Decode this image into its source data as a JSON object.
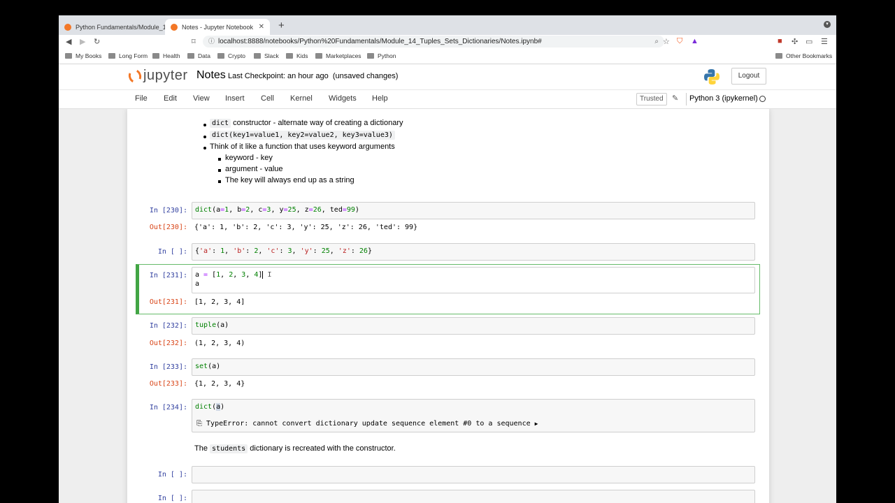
{
  "browser": {
    "tabs": [
      {
        "label": "Python Fundamentals/Module_14_"
      },
      {
        "label": "Notes - Jupyter Notebook"
      }
    ],
    "url": "localhost:8888/notebooks/Python%20Fundamentals/Module_14_Tuples_Sets_Dictionaries/Notes.ipynb#",
    "bookmarks": [
      "My Books",
      "Long Form",
      "Health",
      "Data",
      "Crypto",
      "Slack",
      "Kids",
      "Marketplaces",
      "Python"
    ],
    "other_bookmarks": "Other Bookmarks"
  },
  "jupyter": {
    "logo_text": "jupyter",
    "notebook_name": "Notes",
    "checkpoint": "Last Checkpoint: an hour ago",
    "unsaved": "(unsaved changes)",
    "logout": "Logout",
    "menus": [
      "File",
      "Edit",
      "View",
      "Insert",
      "Cell",
      "Kernel",
      "Widgets",
      "Help"
    ],
    "trusted": "Trusted",
    "kernel": "Python 3 (ipykernel)"
  },
  "markdown": {
    "b1_code": "dict",
    "b1_text": "constructor - alternate way of creating a dictionary",
    "b2_code": "dict(key1=value1, key2=value2, key3=value3)",
    "b3_text": "Think of it like a function that uses keyword arguments",
    "sub1": "keyword - key",
    "sub2": "argument - value",
    "sub3": "The key will always end up as a string"
  },
  "cells": {
    "c230_in": "In [230]:",
    "c230_out_prompt": "Out[230]:",
    "c230_out": "{'a': 1, 'b': 2, 'c': 3, 'y': 25, 'z': 26, 'ted': 99}",
    "blank_in": "In [ ]:",
    "c231_in": "In [231]:",
    "c231_out_prompt": "Out[231]:",
    "c231_out": "[1, 2, 3, 4]",
    "c232_in": "In [232]:",
    "c232_out_prompt": "Out[232]:",
    "c232_out": "(1, 2, 3, 4)",
    "c233_in": "In [233]:",
    "c233_out_prompt": "Out[233]:",
    "c233_out": "{1, 2, 3, 4}",
    "c234_in": "In [234]:",
    "error": "TypeError: cannot convert dictionary update sequence element #0 to a sequence",
    "md2_pre": "The",
    "md2_code": "students",
    "md2_post": "dictionary is recreated with the constructor.",
    "blank_in2": "In [ ]:",
    "blank_in3": "In [ ]:"
  },
  "colors": {
    "prompt_in": "#303f9f",
    "prompt_out": "#d84315",
    "selected_border": "#42a545",
    "jupyter_orange": "#f37726"
  }
}
